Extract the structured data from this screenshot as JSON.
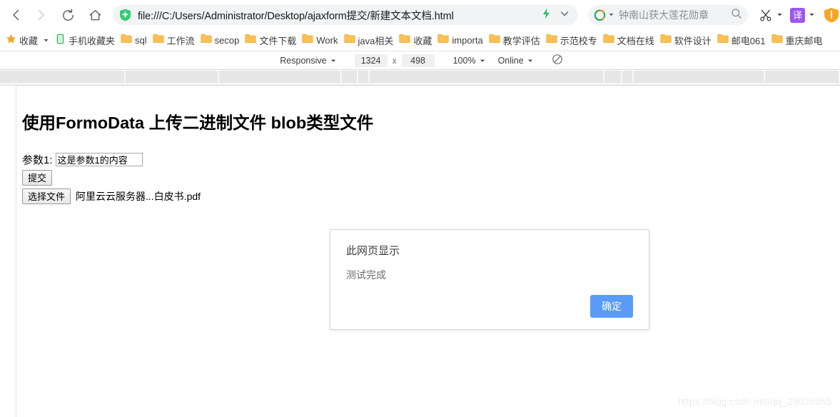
{
  "browser": {
    "nav": {
      "back": "back-arrow",
      "forward": "forward-arrow",
      "reload": "reload",
      "home": "home"
    },
    "address_bar": {
      "favicon": "green-shield-plus-icon",
      "url": "file:///C:/Users/Administrator/Desktop/ajaxform提交/新建文本文档.html",
      "lightning_icon": "lightning-bolt-icon",
      "chevron_icon": "chevron-down-icon"
    },
    "search_bar": {
      "engine_icon": "360-search-icon",
      "engine_caret": "caret-down-icon",
      "query": "钟南山获大莲花勋章",
      "go_icon": "search-icon"
    },
    "extensions": [
      {
        "name": "scissors-icon",
        "glyph": "✂",
        "caret": true
      },
      {
        "name": "translate-icon",
        "glyph": "译",
        "caret": true
      },
      {
        "name": "shield-security-icon",
        "glyph": "",
        "caret": false
      }
    ]
  },
  "bookmarks": [
    {
      "label": "收藏",
      "icon": "star-icon",
      "caret": true
    },
    {
      "label": "手机收藏夹",
      "icon": "phone-icon",
      "caret": false
    },
    {
      "label": "sql",
      "icon": "folder-icon",
      "caret": false
    },
    {
      "label": "工作流",
      "icon": "folder-icon",
      "caret": false
    },
    {
      "label": "secop",
      "icon": "folder-icon",
      "caret": false
    },
    {
      "label": "文件下载",
      "icon": "folder-icon",
      "caret": false
    },
    {
      "label": "Work",
      "icon": "folder-icon",
      "caret": false
    },
    {
      "label": "java相关",
      "icon": "folder-icon",
      "caret": false
    },
    {
      "label": "收藏",
      "icon": "folder-icon",
      "caret": false
    },
    {
      "label": "importa",
      "icon": "folder-icon",
      "caret": false
    },
    {
      "label": "教学评估",
      "icon": "folder-icon",
      "caret": false
    },
    {
      "label": "示范校专",
      "icon": "folder-icon",
      "caret": false
    },
    {
      "label": "文档在线",
      "icon": "folder-icon",
      "caret": false
    },
    {
      "label": "软件设计",
      "icon": "folder-icon",
      "caret": false
    },
    {
      "label": "邮电061",
      "icon": "folder-icon",
      "caret": false
    },
    {
      "label": "重庆邮电",
      "icon": "folder-icon",
      "caret": false
    }
  ],
  "responsive_toolbar": {
    "device": "Responsive",
    "device_caret": "caret-down-icon",
    "width": "1324",
    "separator": "x",
    "height": "498",
    "zoom": "100%",
    "zoom_caret": "caret-down-icon",
    "throttling": "Online",
    "throttling_caret": "caret-down-icon",
    "disable_cache_icon": "no-cache-icon"
  },
  "page": {
    "heading": "使用FormoData 上传二进制文件 blob类型文件",
    "form": {
      "param1_label": "参数1:",
      "param1_value": "这是参数1的内容",
      "submit_label": "提交",
      "file_button_label": "选择文件",
      "file_name": "阿里云云服务器...白皮书.pdf"
    },
    "dialog": {
      "title": "此网页显示",
      "message": "测试完成",
      "ok_label": "确定",
      "accent_color": "#5b9bf8"
    },
    "watermark": "https://blog.csdn.net/qq_29025955"
  }
}
